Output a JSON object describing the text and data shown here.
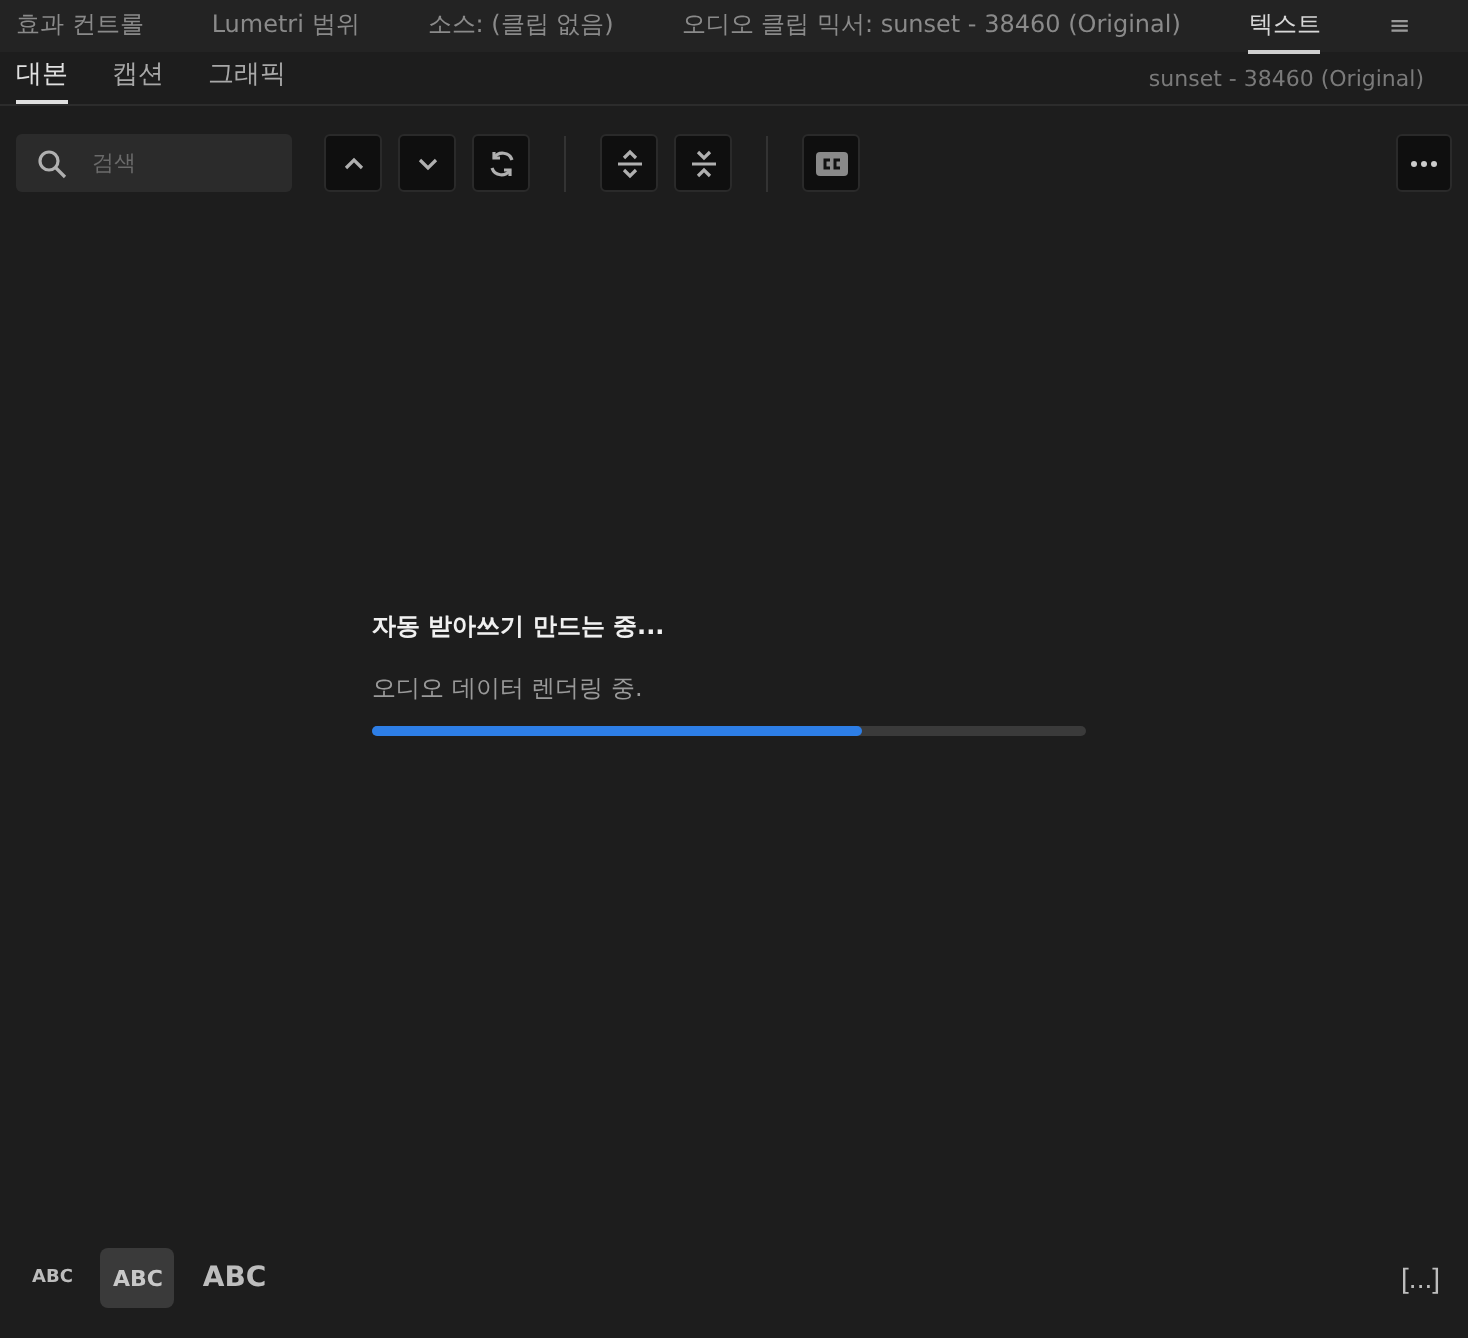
{
  "panel_tabs": [
    {
      "label": "효과 컨트롤",
      "selected": false
    },
    {
      "label": "Lumetri 범위",
      "selected": false
    },
    {
      "label": "소스: (클립 없음)",
      "selected": false
    },
    {
      "label": "오디오 클립 믹서: sunset - 38460 (Original)",
      "selected": false
    },
    {
      "label": "텍스트",
      "selected": true
    }
  ],
  "panel_menu": "≡",
  "sub_tabs": [
    {
      "label": "대본",
      "selected": true
    },
    {
      "label": "캡션",
      "selected": false
    },
    {
      "label": "그래픽",
      "selected": false
    }
  ],
  "sequence": "sunset - 38460 (Original)",
  "search": {
    "placeholder": "검색"
  },
  "toolbar": [
    {
      "kind": "up"
    },
    {
      "kind": "down"
    },
    {
      "kind": "refresh"
    },
    {
      "kind": "sep"
    },
    {
      "kind": "expand"
    },
    {
      "kind": "collapse"
    },
    {
      "kind": "sep"
    },
    {
      "kind": "cc"
    }
  ],
  "progress": {
    "title": "자동 받아쓰기 만드는 중...",
    "status": "오디오 데이터 렌더링 중.",
    "level": 0.686
  },
  "text_sizes": [
    {
      "label": "ABC",
      "kind": "small",
      "selected": false
    },
    {
      "label": "ABC",
      "kind": "medium",
      "selected": true
    },
    {
      "label": "ABC",
      "kind": "large",
      "selected": false
    }
  ],
  "bracket_button": "[...]"
}
